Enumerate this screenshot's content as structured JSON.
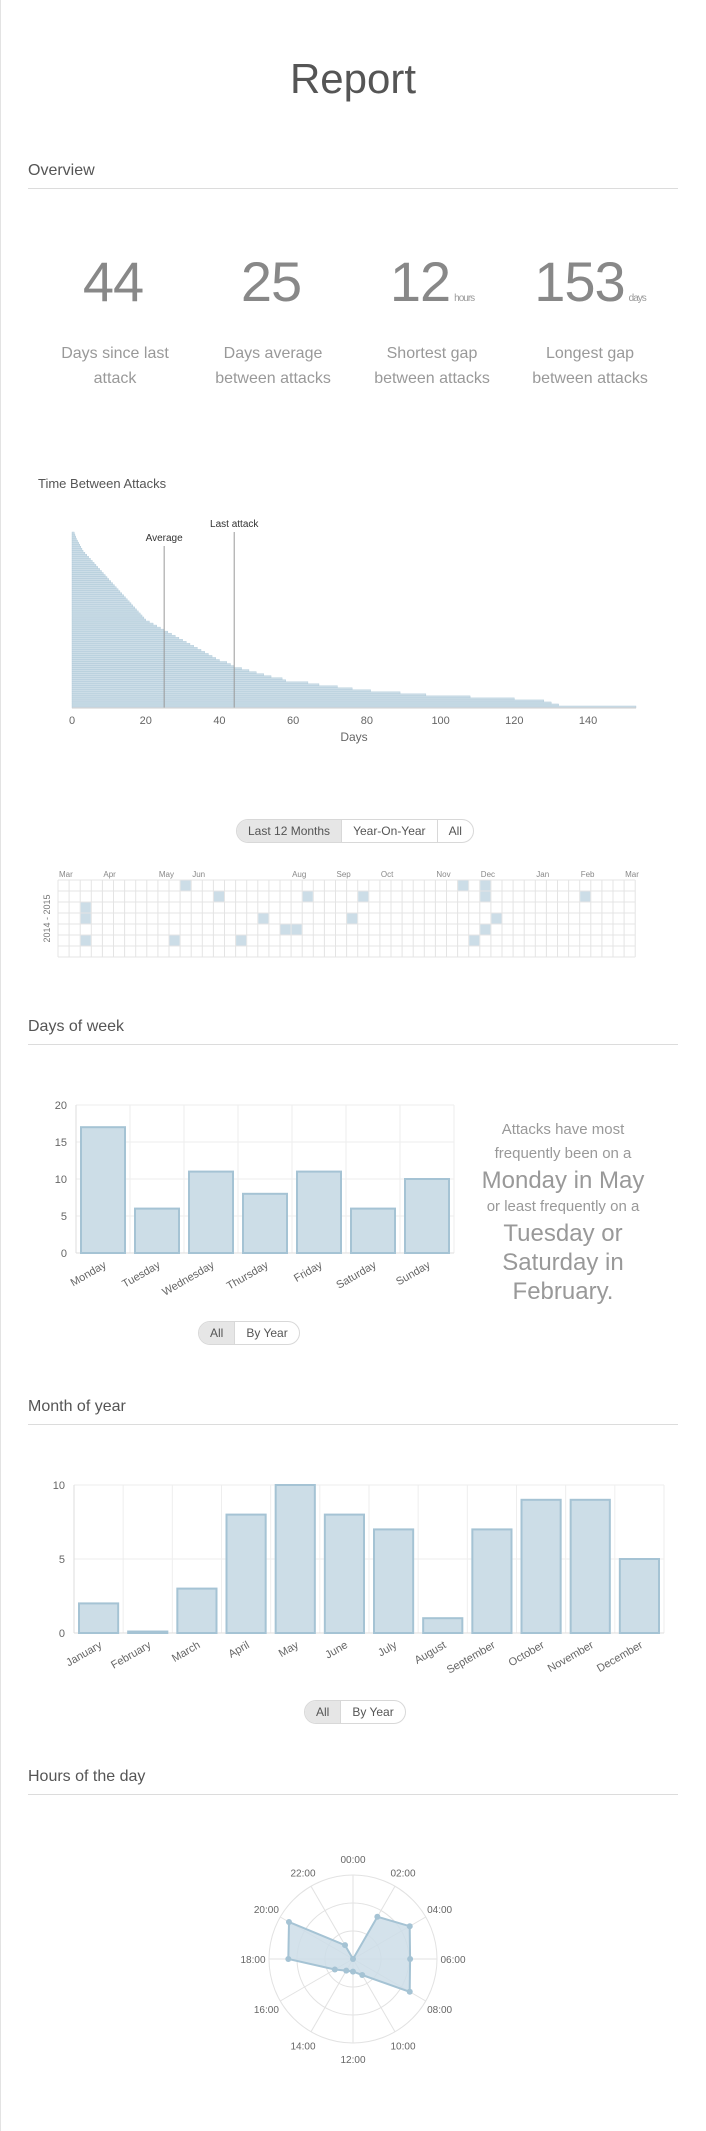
{
  "title": "Report",
  "sections": {
    "overview": "Overview",
    "days_of_week": "Days of week",
    "month_of_year": "Month of year",
    "hours_of_day": "Hours of the day"
  },
  "stats": [
    {
      "value": "44",
      "unit": "",
      "label": "Days since last attack"
    },
    {
      "value": "25",
      "unit": "",
      "label": "Days average between attacks"
    },
    {
      "value": "12",
      "unit": "hours",
      "label": "Shortest gap between attacks"
    },
    {
      "value": "153",
      "unit": "days",
      "label": "Longest gap between attacks"
    }
  ],
  "filters": {
    "calendar": [
      {
        "label": "Last 12 Months",
        "active": true
      },
      {
        "label": "Year-On-Year",
        "active": false
      },
      {
        "label": "All",
        "active": false
      }
    ],
    "dow": [
      {
        "label": "All",
        "active": true
      },
      {
        "label": "By Year",
        "active": false
      }
    ],
    "month": [
      {
        "label": "All",
        "active": true
      },
      {
        "label": "By Year",
        "active": false
      }
    ]
  },
  "summary": {
    "s1": "Attacks have most frequently been on a",
    "l1": "Monday in May",
    "s2": "or least frequently on a",
    "l2": "Tuesday or Saturday in February."
  },
  "colors": {
    "bar_fill": "#ccdde7",
    "bar_stroke": "#a5c3d4",
    "grid": "#eeeeee",
    "axis_text": "#666666"
  },
  "chart_data": [
    {
      "type": "bar",
      "orientation": "horizontal",
      "title": "Time Between Attacks",
      "xlabel": "Days",
      "xlim": [
        0,
        153
      ],
      "xticks": [
        0,
        20,
        40,
        60,
        80,
        100,
        120,
        140
      ],
      "values": [
        153,
        132,
        130,
        128,
        120,
        108,
        96,
        89,
        81,
        76,
        72,
        67,
        64,
        58,
        57,
        54,
        52,
        50,
        48,
        46,
        44,
        43,
        42,
        40,
        39,
        38,
        37,
        36,
        35,
        34,
        33,
        32,
        31,
        30,
        29,
        28,
        27,
        26,
        25,
        24,
        23,
        22,
        21,
        20,
        19.5,
        19,
        18.5,
        18,
        17.5,
        17,
        16.5,
        16,
        15.5,
        15,
        14.5,
        14,
        13.5,
        13,
        12.5,
        12,
        11.5,
        11,
        10.5,
        10,
        9.5,
        9,
        8.5,
        8,
        7.5,
        7,
        6.5,
        6,
        5.5,
        5,
        4.5,
        4,
        3.5,
        3,
        2.7,
        2.4,
        2.1,
        1.8,
        1.5,
        1.2,
        1,
        0.8,
        0.6
      ],
      "markers": [
        {
          "label": "Average",
          "value": 25
        },
        {
          "label": "Last attack",
          "value": 44
        }
      ]
    },
    {
      "type": "heatmap",
      "series_label": "2014 - 2015",
      "month_labels": [
        {
          "label": "Mar",
          "week": 0
        },
        {
          "label": "Apr",
          "week": 4
        },
        {
          "label": "May",
          "week": 9
        },
        {
          "label": "Jun",
          "week": 12
        },
        {
          "label": "Aug",
          "week": 21
        },
        {
          "label": "Sep",
          "week": 25
        },
        {
          "label": "Oct",
          "week": 29
        },
        {
          "label": "Nov",
          "week": 34
        },
        {
          "label": "Dec",
          "week": 38
        },
        {
          "label": "Jan",
          "week": 43
        },
        {
          "label": "Feb",
          "week": 47
        },
        {
          "label": "Mar",
          "week": 51
        }
      ],
      "weeks": 52,
      "days": 7,
      "attacks": [
        [
          2,
          2
        ],
        [
          2,
          3
        ],
        [
          2,
          5
        ],
        [
          10,
          5
        ],
        [
          11,
          0
        ],
        [
          14,
          1
        ],
        [
          16,
          5
        ],
        [
          18,
          3
        ],
        [
          20,
          4
        ],
        [
          21,
          4
        ],
        [
          22,
          1
        ],
        [
          26,
          3
        ],
        [
          27,
          1
        ],
        [
          36,
          0
        ],
        [
          37,
          5
        ],
        [
          38,
          0
        ],
        [
          38,
          1
        ],
        [
          38,
          4
        ],
        [
          39,
          3
        ],
        [
          47,
          1
        ]
      ]
    },
    {
      "type": "bar",
      "title": "Days of week",
      "categories": [
        "Monday",
        "Tuesday",
        "Wednesday",
        "Thursday",
        "Friday",
        "Saturday",
        "Sunday"
      ],
      "values": [
        17,
        6,
        11,
        8,
        11,
        6,
        10
      ],
      "ylim": [
        0,
        20
      ],
      "yticks": [
        0,
        5,
        10,
        15,
        20
      ]
    },
    {
      "type": "bar",
      "title": "Month of year",
      "categories": [
        "January",
        "February",
        "March",
        "April",
        "May",
        "June",
        "July",
        "August",
        "September",
        "October",
        "November",
        "December"
      ],
      "values": [
        2,
        0.1,
        3,
        8,
        10,
        8,
        7,
        1,
        7,
        9,
        9,
        5
      ],
      "ylim": [
        0,
        10
      ],
      "yticks": [
        0,
        5,
        10
      ]
    },
    {
      "type": "radar",
      "title": "Hours of the day",
      "categories": [
        "00:00",
        "02:00",
        "04:00",
        "06:00",
        "08:00",
        "10:00",
        "12:00",
        "14:00",
        "16:00",
        "18:00",
        "20:00",
        "22:00"
      ],
      "values": [
        0,
        0.58,
        0.78,
        0.68,
        0.78,
        0.22,
        0.15,
        0.16,
        0.25,
        0.77,
        0.88,
        0.19
      ],
      "rmax": 1
    }
  ]
}
